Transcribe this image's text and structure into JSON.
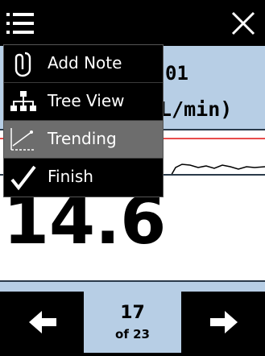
{
  "header": {
    "menu_icon": "hamburger-icon",
    "close_icon": "close-icon"
  },
  "reading": {
    "id_partial": "01",
    "unit_partial": "L/min)",
    "value": "14.6"
  },
  "menu": {
    "items": [
      {
        "label": "Add Note",
        "icon": "paperclip-icon"
      },
      {
        "label": "Tree View",
        "icon": "tree-icon"
      },
      {
        "label": "Trending",
        "icon": "trend-chart-icon"
      },
      {
        "label": "Finish",
        "icon": "checkmark-icon"
      }
    ],
    "active_index": 2
  },
  "pager": {
    "current": "17",
    "total_label": "of 23"
  },
  "colors": {
    "background": "#b7cee5",
    "bar": "#000000",
    "menu_active": "#6d6d6d",
    "limit_line": "#e01010"
  }
}
